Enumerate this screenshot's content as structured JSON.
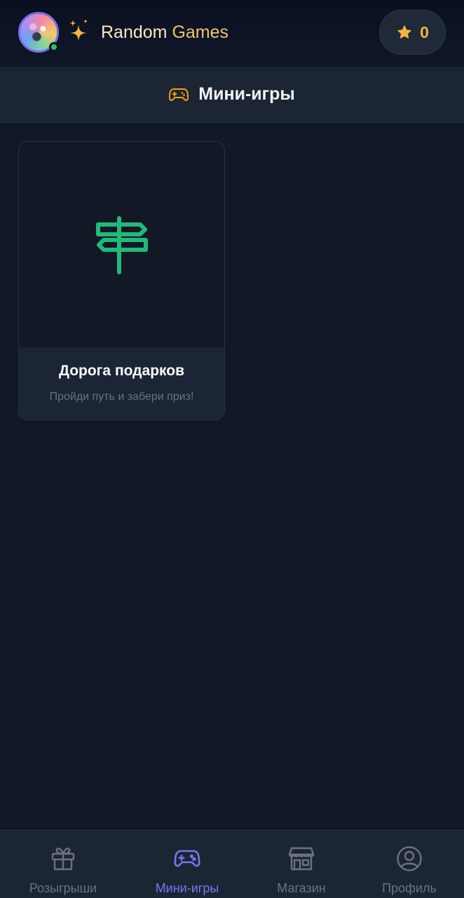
{
  "header": {
    "brand_part1": "Random",
    "brand_part2": "Games",
    "stars_count": "0",
    "avatar_status": "online"
  },
  "section": {
    "title": "Мини-игры",
    "icon": "gamepad-icon"
  },
  "games": [
    {
      "title": "Дорога подарков",
      "subtitle": "Пройди путь и забери приз!",
      "icon": "signpost-icon"
    }
  ],
  "nav": {
    "active": "Мини-игры",
    "items": [
      {
        "label": "Розыгрыши",
        "icon": "gift-icon"
      },
      {
        "label": "Мини-игры",
        "icon": "gamepad-icon"
      },
      {
        "label": "Магазин",
        "icon": "store-icon"
      },
      {
        "label": "Профиль",
        "icon": "user-circle-icon"
      }
    ]
  },
  "colors": {
    "background": "#111827",
    "accent": "#7c74f0",
    "gold": "#f5b53b",
    "signpost_green": "#22b97a",
    "online": "#22c55e"
  }
}
